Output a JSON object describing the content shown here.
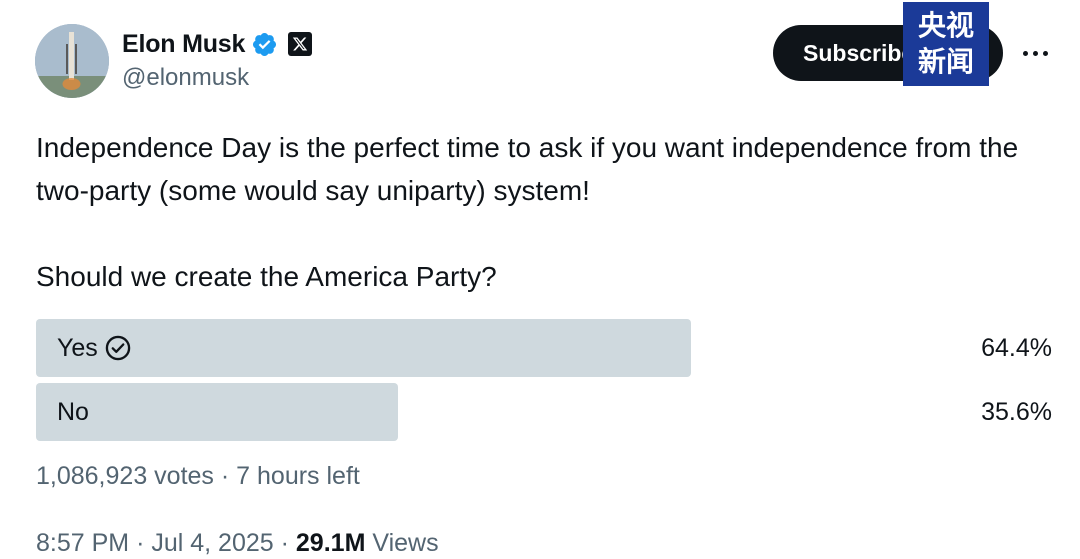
{
  "author": {
    "display_name": "Elon Musk",
    "handle": "@elonmusk",
    "verified_color": "#1d9bf0"
  },
  "actions": {
    "subscribe_label": "Subscribe"
  },
  "watermark": {
    "line1": "央视",
    "line2": "新闻"
  },
  "tweet": {
    "text": "Independence Day is the perfect time to ask if you want independence from the two-party (some would say uniparty) system!",
    "question": "Should we create the America Party?"
  },
  "poll": {
    "options": [
      {
        "label": "Yes",
        "percent": "64.4%",
        "value": 64.4,
        "selected": true
      },
      {
        "label": "No",
        "percent": "35.6%",
        "value": 35.6,
        "selected": false
      }
    ],
    "votes": "1,086,923 votes",
    "separator": "·",
    "time_left": "7 hours left",
    "bar_color": "#cfd9de"
  },
  "meta": {
    "time": "8:57 PM",
    "date": "Jul 4, 2025",
    "separator": "·",
    "views_count": "29.1M",
    "views_label": "Views"
  }
}
